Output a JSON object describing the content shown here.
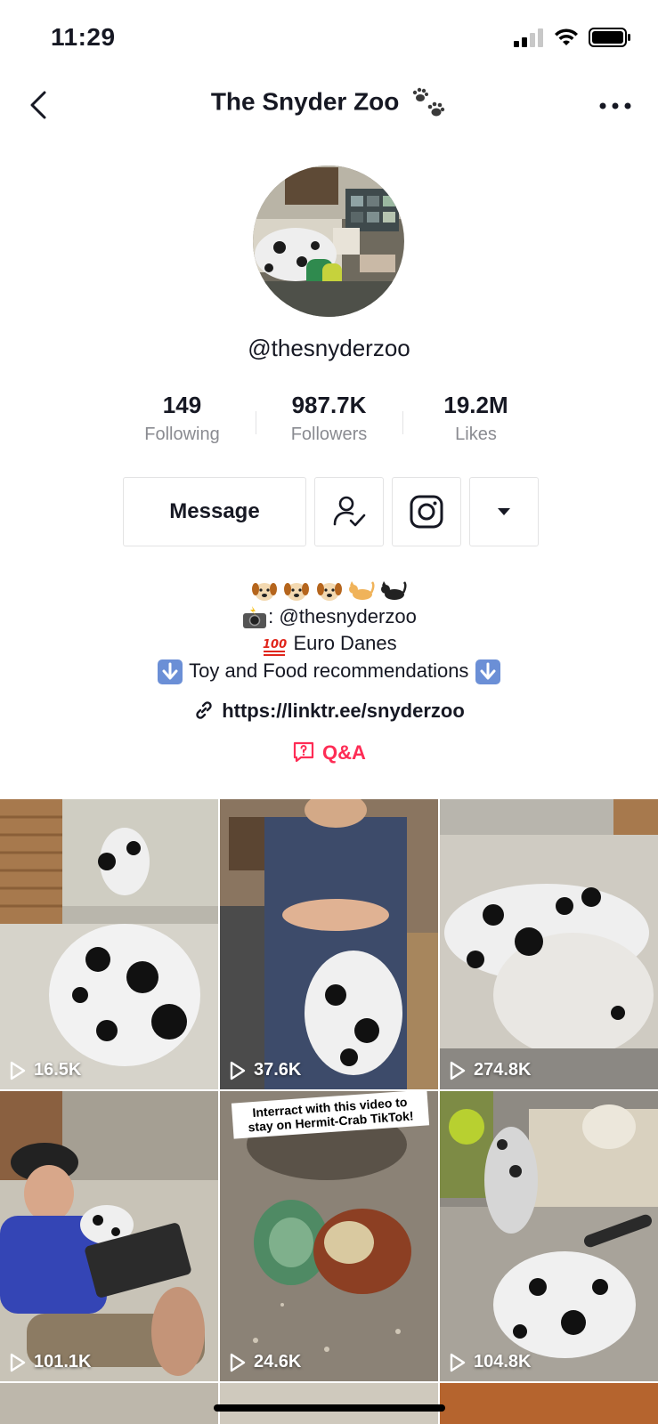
{
  "status_bar": {
    "time": "11:29"
  },
  "header": {
    "title": "The Snyder Zoo"
  },
  "profile": {
    "username": "@thesnyderzoo",
    "stats": [
      {
        "value": "149",
        "label": "Following"
      },
      {
        "value": "987.7K",
        "label": "Followers"
      },
      {
        "value": "19.2M",
        "label": "Likes"
      }
    ]
  },
  "actions": {
    "message_label": "Message"
  },
  "bio": {
    "line2": ": @thesnyderzoo",
    "line3": "Euro Danes",
    "line4": "Toy and Food recommendations",
    "link": "https://linktr.ee/snyderzoo",
    "qa": "Q&A"
  },
  "videos": [
    {
      "views": "16.5K"
    },
    {
      "views": "37.6K"
    },
    {
      "views": "274.8K"
    },
    {
      "views": "101.1K"
    },
    {
      "views": "24.6K",
      "caption": "Interract with this video to stay on Hermit-Crab TikTok!"
    },
    {
      "views": "104.8K"
    }
  ],
  "colors": {
    "accent": "#fe2c55",
    "text": "#161823",
    "secondary": "#8a8b91",
    "border": "#e3e3e4"
  }
}
